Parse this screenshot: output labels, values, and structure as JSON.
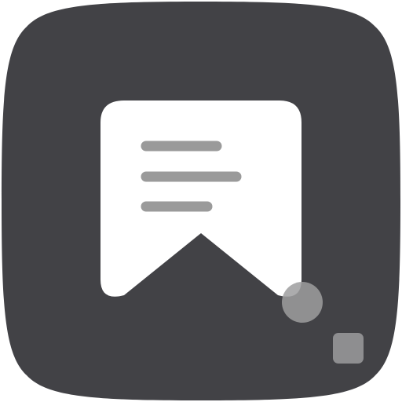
{
  "icon": {
    "name": "bookmark-notes-app-icon",
    "colors": {
      "tile": "#424246",
      "bookmark": "#ffffff",
      "text_lines": "#9a9a9a",
      "circle": "#9d9d9f",
      "square": "#8e8e90"
    }
  }
}
